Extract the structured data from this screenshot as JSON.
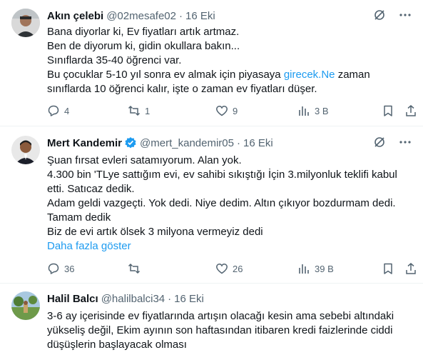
{
  "tweets": [
    {
      "name": "Akın çelebi",
      "handle": "@02mesafe02",
      "dot": "·",
      "date": "16 Eki",
      "lines": [
        "Bana diyorlar ki, Ev fiyatları artık artmaz.",
        "Ben de diyorum ki, gidin okullara bakın...",
        "Sınıflarda 35-40 öğrenci var."
      ],
      "line4_pre": "Bu çocuklar 5-10 yıl sonra ev almak için piyasaya ",
      "line4_link": "girecek.Ne",
      "line4_post": " zaman",
      "line5": "sınıflarda 10 öğrenci kalır, işte o zaman ev fiyatları düşer.",
      "replies": "4",
      "retweets": "1",
      "likes": "9",
      "views": "3 B"
    },
    {
      "name": "Mert Kandemir",
      "handle": "@mert_kandemir05",
      "dot": "·",
      "date": "16 Eki",
      "lines": [
        "Şuan fırsat evleri satamıyorum. Alan yok.",
        "4.300 bin 'TLye sattığım evi, ev sahibi sıkıştığı İçin 3.milyonluk teklifi kabul",
        "etti. Satıcaz dedik.",
        "Adam geldi vazgeçti. Yok dedi. Niye dedim. Altın çıkıyor bozdurmam dedi.",
        "Tamam dedik",
        "Biz de evi artık ölsek 3 milyona vermeyiz dedi"
      ],
      "show_more": "Daha fazla göster",
      "replies": "36",
      "retweets": "",
      "likes": "26",
      "views": "39 B"
    },
    {
      "name": "Halil Balcı",
      "handle": "@halilbalci34",
      "dot": "·",
      "date": "16 Eki",
      "lines": [
        "3-6 ay içerisinde ev fiyatlarında artışın olacağı kesin ama sebebi altındaki",
        "yükseliş değil, Ekim ayının son haftasından itibaren kredi faizlerinde ciddi",
        "düşüşlerin başlayacak olması"
      ]
    }
  ],
  "colors": {
    "link": "#1d9bf0",
    "secondary_text": "#536471",
    "verified": "#1d9bf0"
  }
}
